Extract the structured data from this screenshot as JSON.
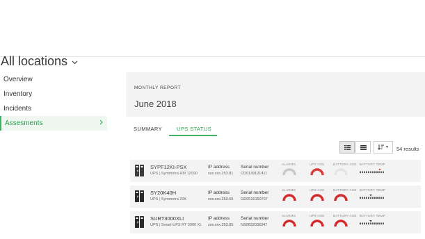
{
  "header": {
    "title": "All locations"
  },
  "sidebar": {
    "items": [
      {
        "label": "Overview",
        "active": false
      },
      {
        "label": "Inventory",
        "active": false
      },
      {
        "label": "Incidents",
        "active": false
      },
      {
        "label": "Assesments",
        "active": true
      }
    ]
  },
  "report": {
    "label": "MONTHLY REPORT",
    "month": "June 2018"
  },
  "tabs": [
    {
      "label": "SUMMARY",
      "active": false
    },
    {
      "label": "UPS STATUS",
      "active": true
    }
  ],
  "toolbar": {
    "results": "54 results",
    "view_mode": "list"
  },
  "columns": {
    "ip": "IP address",
    "serial": "Serial number",
    "alarms": "ALARMS",
    "ups_age": "UPS AGE",
    "battery_age": "BATTERY AGE",
    "battery_temp": "BATTERY TEMP"
  },
  "colors": {
    "accent": "#3db262",
    "alert": "#d42a2a",
    "muted": "#c8c8c8"
  },
  "rows": [
    {
      "name": "SYPF12KI-PSX",
      "subtitle": "UPS | Symmetra RM 12000",
      "ip": "xxx.xxx.253.81",
      "serial": "CD0139121411",
      "alarms": "grey",
      "ups_age": "red",
      "battery_age": "light",
      "temp_marker": "red",
      "dimmed": true
    },
    {
      "name": "SY20K40H",
      "subtitle": "UPS | Symmetra 20K",
      "ip": "xxx.xxx.253.65",
      "serial": "GD0516150767",
      "alarms": "red",
      "ups_age": "red",
      "battery_age": "red",
      "temp_marker": "dark",
      "dimmed": false
    },
    {
      "name": "SURT3000XLI",
      "subtitle": "UPS | Smart-UPS RT 3000 XL",
      "ip": "xxx.xxx.253.85",
      "serial": "NS0632036347",
      "alarms": "red",
      "ups_age": "red",
      "battery_age": "red",
      "temp_marker": "dark",
      "dimmed": false
    }
  ]
}
